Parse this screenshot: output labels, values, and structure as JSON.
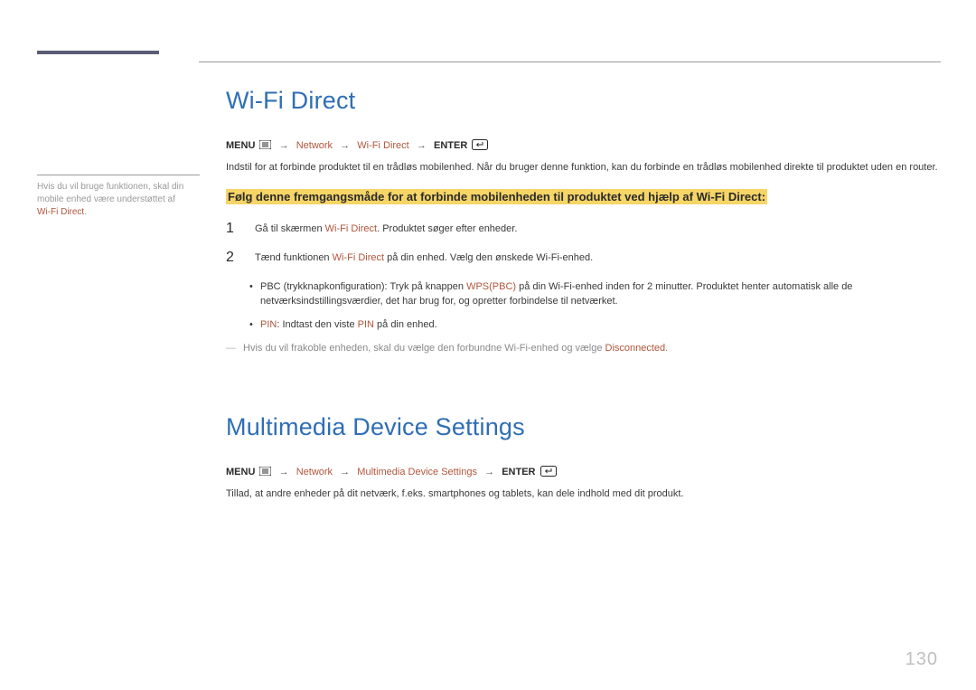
{
  "pageNumber": "130",
  "sideNote": {
    "line1": "Hvis du vil bruge funktionen, skal din",
    "line2": "mobile enhed være understøttet af",
    "term": "Wi-Fi Direct",
    "period": "."
  },
  "wifi": {
    "title": "Wi-Fi Direct",
    "nav": {
      "menu": "MENU",
      "item1": "Network",
      "item2": "Wi-Fi Direct",
      "enter": "ENTER"
    },
    "intro": "Indstil for at forbinde produktet til en trådløs mobilenhed. Når du bruger denne funktion, kan du forbinde en trådløs mobilenhed direkte til produktet uden en router.",
    "highlight": "Følg denne fremgangsmåde for at forbinde mobilenheden til produktet ved hjælp af Wi-Fi Direct:",
    "step1": {
      "num": "1",
      "t1": "Gå til skærmen ",
      "term": "Wi-Fi Direct",
      "t2": ". Produktet søger efter enheder."
    },
    "step2": {
      "num": "2",
      "t1": "Tænd funktionen ",
      "term": "Wi-Fi Direct",
      "t2": " på din enhed. Vælg den ønskede Wi-Fi-enhed."
    },
    "bullet1": {
      "t1": "PBC (trykknapkonfiguration): Tryk på knappen ",
      "term": "WPS(PBC)",
      "t2": " på din Wi-Fi-enhed inden for 2 minutter. Produktet henter automatisk alle de netværksindstillingsværdier, det har brug for, og opretter forbindelse til netværket."
    },
    "bullet2": {
      "termA": "PIN",
      "t1": ": Indtast den viste ",
      "termB": "PIN",
      "t2": " på din enhed."
    },
    "footnote": {
      "t1": "Hvis du vil frakoble enheden, skal du vælge den forbundne Wi-Fi-enhed og vælge ",
      "term": "Disconnected",
      "t2": "."
    }
  },
  "mm": {
    "title": "Multimedia Device Settings",
    "nav": {
      "menu": "MENU",
      "item1": "Network",
      "item2": "Multimedia Device Settings",
      "enter": "ENTER"
    },
    "para": "Tillad, at andre enheder på dit netværk, f.eks. smartphones og tablets, kan dele indhold med dit produkt."
  }
}
